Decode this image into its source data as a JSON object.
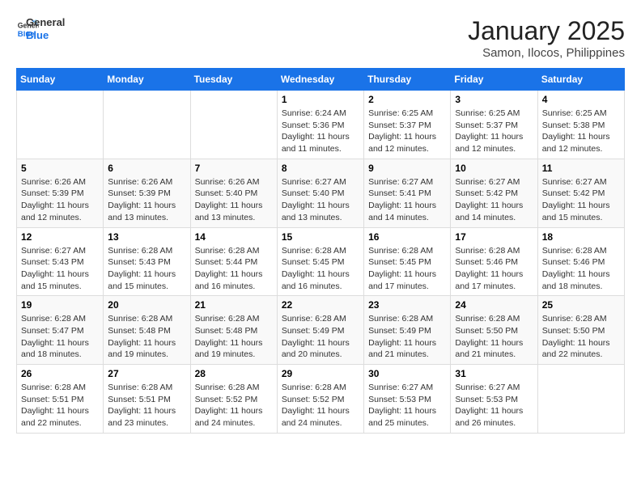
{
  "header": {
    "logo_general": "General",
    "logo_blue": "Blue",
    "month_year": "January 2025",
    "location": "Samon, Ilocos, Philippines"
  },
  "weekdays": [
    "Sunday",
    "Monday",
    "Tuesday",
    "Wednesday",
    "Thursday",
    "Friday",
    "Saturday"
  ],
  "weeks": [
    [
      {
        "day": "",
        "info": ""
      },
      {
        "day": "",
        "info": ""
      },
      {
        "day": "",
        "info": ""
      },
      {
        "day": "1",
        "info": "Sunrise: 6:24 AM\nSunset: 5:36 PM\nDaylight: 11 hours\nand 11 minutes."
      },
      {
        "day": "2",
        "info": "Sunrise: 6:25 AM\nSunset: 5:37 PM\nDaylight: 11 hours\nand 12 minutes."
      },
      {
        "day": "3",
        "info": "Sunrise: 6:25 AM\nSunset: 5:37 PM\nDaylight: 11 hours\nand 12 minutes."
      },
      {
        "day": "4",
        "info": "Sunrise: 6:25 AM\nSunset: 5:38 PM\nDaylight: 11 hours\nand 12 minutes."
      }
    ],
    [
      {
        "day": "5",
        "info": "Sunrise: 6:26 AM\nSunset: 5:39 PM\nDaylight: 11 hours\nand 12 minutes."
      },
      {
        "day": "6",
        "info": "Sunrise: 6:26 AM\nSunset: 5:39 PM\nDaylight: 11 hours\nand 13 minutes."
      },
      {
        "day": "7",
        "info": "Sunrise: 6:26 AM\nSunset: 5:40 PM\nDaylight: 11 hours\nand 13 minutes."
      },
      {
        "day": "8",
        "info": "Sunrise: 6:27 AM\nSunset: 5:40 PM\nDaylight: 11 hours\nand 13 minutes."
      },
      {
        "day": "9",
        "info": "Sunrise: 6:27 AM\nSunset: 5:41 PM\nDaylight: 11 hours\nand 14 minutes."
      },
      {
        "day": "10",
        "info": "Sunrise: 6:27 AM\nSunset: 5:42 PM\nDaylight: 11 hours\nand 14 minutes."
      },
      {
        "day": "11",
        "info": "Sunrise: 6:27 AM\nSunset: 5:42 PM\nDaylight: 11 hours\nand 15 minutes."
      }
    ],
    [
      {
        "day": "12",
        "info": "Sunrise: 6:27 AM\nSunset: 5:43 PM\nDaylight: 11 hours\nand 15 minutes."
      },
      {
        "day": "13",
        "info": "Sunrise: 6:28 AM\nSunset: 5:43 PM\nDaylight: 11 hours\nand 15 minutes."
      },
      {
        "day": "14",
        "info": "Sunrise: 6:28 AM\nSunset: 5:44 PM\nDaylight: 11 hours\nand 16 minutes."
      },
      {
        "day": "15",
        "info": "Sunrise: 6:28 AM\nSunset: 5:45 PM\nDaylight: 11 hours\nand 16 minutes."
      },
      {
        "day": "16",
        "info": "Sunrise: 6:28 AM\nSunset: 5:45 PM\nDaylight: 11 hours\nand 17 minutes."
      },
      {
        "day": "17",
        "info": "Sunrise: 6:28 AM\nSunset: 5:46 PM\nDaylight: 11 hours\nand 17 minutes."
      },
      {
        "day": "18",
        "info": "Sunrise: 6:28 AM\nSunset: 5:46 PM\nDaylight: 11 hours\nand 18 minutes."
      }
    ],
    [
      {
        "day": "19",
        "info": "Sunrise: 6:28 AM\nSunset: 5:47 PM\nDaylight: 11 hours\nand 18 minutes."
      },
      {
        "day": "20",
        "info": "Sunrise: 6:28 AM\nSunset: 5:48 PM\nDaylight: 11 hours\nand 19 minutes."
      },
      {
        "day": "21",
        "info": "Sunrise: 6:28 AM\nSunset: 5:48 PM\nDaylight: 11 hours\nand 19 minutes."
      },
      {
        "day": "22",
        "info": "Sunrise: 6:28 AM\nSunset: 5:49 PM\nDaylight: 11 hours\nand 20 minutes."
      },
      {
        "day": "23",
        "info": "Sunrise: 6:28 AM\nSunset: 5:49 PM\nDaylight: 11 hours\nand 21 minutes."
      },
      {
        "day": "24",
        "info": "Sunrise: 6:28 AM\nSunset: 5:50 PM\nDaylight: 11 hours\nand 21 minutes."
      },
      {
        "day": "25",
        "info": "Sunrise: 6:28 AM\nSunset: 5:50 PM\nDaylight: 11 hours\nand 22 minutes."
      }
    ],
    [
      {
        "day": "26",
        "info": "Sunrise: 6:28 AM\nSunset: 5:51 PM\nDaylight: 11 hours\nand 22 minutes."
      },
      {
        "day": "27",
        "info": "Sunrise: 6:28 AM\nSunset: 5:51 PM\nDaylight: 11 hours\nand 23 minutes."
      },
      {
        "day": "28",
        "info": "Sunrise: 6:28 AM\nSunset: 5:52 PM\nDaylight: 11 hours\nand 24 minutes."
      },
      {
        "day": "29",
        "info": "Sunrise: 6:28 AM\nSunset: 5:52 PM\nDaylight: 11 hours\nand 24 minutes."
      },
      {
        "day": "30",
        "info": "Sunrise: 6:27 AM\nSunset: 5:53 PM\nDaylight: 11 hours\nand 25 minutes."
      },
      {
        "day": "31",
        "info": "Sunrise: 6:27 AM\nSunset: 5:53 PM\nDaylight: 11 hours\nand 26 minutes."
      },
      {
        "day": "",
        "info": ""
      }
    ]
  ]
}
